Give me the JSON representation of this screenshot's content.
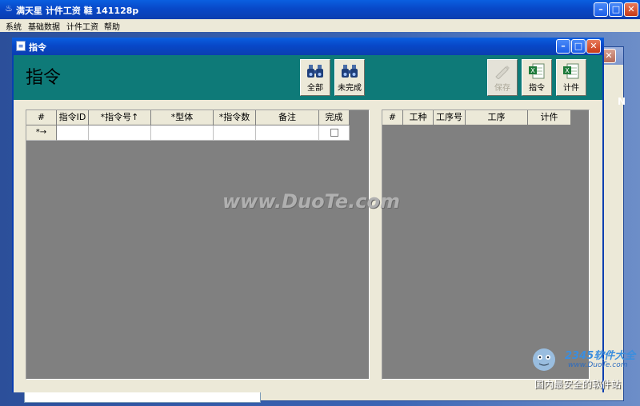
{
  "app": {
    "title": "满天星 计件工资 鞋 141128p",
    "icon": "app-icon"
  },
  "menu": [
    "系统",
    "基础数据",
    "计件工资",
    "帮助"
  ],
  "behind_window": {
    "letter": "N"
  },
  "child_window": {
    "title": "指令",
    "heading": "指令"
  },
  "toolbar": {
    "buttons": [
      {
        "label": "全部",
        "icon": "binoculars-icon"
      },
      {
        "label": "未完成",
        "icon": "binoculars-icon"
      },
      {
        "label": "保存",
        "icon": "pen-icon",
        "disabled": true
      },
      {
        "label": "指令",
        "icon": "excel-icon"
      },
      {
        "label": "计件",
        "icon": "excel-icon"
      }
    ]
  },
  "left_grid": {
    "columns": [
      "#",
      "指令ID",
      "*指令号↑",
      "*型体",
      "*指令数",
      "备注",
      "完成"
    ],
    "new_row_marker": "*→"
  },
  "right_grid": {
    "columns": [
      "#",
      "工种",
      "工序号",
      "工序",
      "计件"
    ]
  },
  "watermark": "www.DuoTe.com",
  "logo": {
    "brand": "2345软件大全",
    "url": "www.DuoTe.com",
    "slogan": "国内最安全的软件站"
  },
  "colors": {
    "toolbar_bg": "#0e7a78",
    "grid_bg": "#808080",
    "titlebar": "#0848c8"
  }
}
